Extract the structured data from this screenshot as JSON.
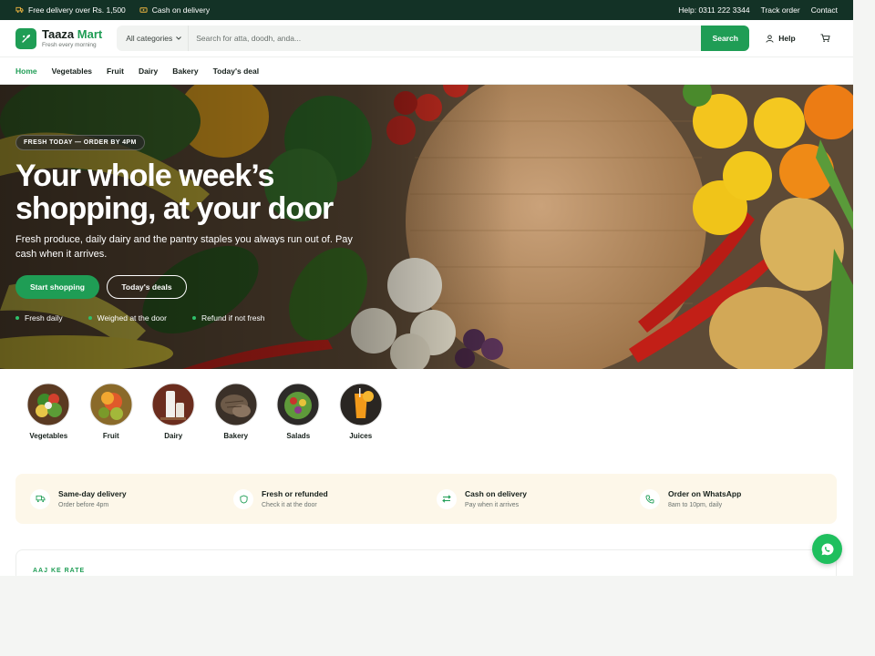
{
  "topbar": {
    "left": [
      {
        "icon": "truck-icon",
        "label": "Free delivery over Rs. 1,500"
      },
      {
        "icon": "cash-icon",
        "label": "Cash on delivery"
      }
    ],
    "right": [
      "Help: 0311 222 3344",
      "Track order",
      "Contact"
    ]
  },
  "header": {
    "brand_first": "Taaza",
    "brand_second": "Mart",
    "tagline": "Fresh every morning",
    "category_select": "All categories",
    "search_placeholder": "Search for atta, doodh, anda...",
    "search_button": "Search",
    "help_label": "Help"
  },
  "nav": [
    "Home",
    "Vegetables",
    "Fruit",
    "Dairy",
    "Bakery",
    "Today's deal"
  ],
  "hero": {
    "badge": "FRESH TODAY — ORDER BY 4PM",
    "title_line1": "Your whole week’s",
    "title_line2": "shopping, at your door",
    "subtitle": "Fresh produce, daily dairy and the pantry staples you always run out of. Pay cash when it arrives.",
    "primary_cta": "Start shopping",
    "secondary_cta": "Today's deals",
    "ticks": [
      "Fresh daily",
      "Weighed at the door",
      "Refund if not fresh"
    ]
  },
  "categories": [
    "Vegetables",
    "Fruit",
    "Dairy",
    "Bakery",
    "Salads",
    "Juices"
  ],
  "features": [
    {
      "icon": "truck-icon",
      "title": "Same-day delivery",
      "sub": "Order before 4pm"
    },
    {
      "icon": "shield-icon",
      "title": "Fresh or refunded",
      "sub": "Check it at the door"
    },
    {
      "icon": "swap-icon",
      "title": "Cash on delivery",
      "sub": "Pay when it arrives"
    },
    {
      "icon": "phone-icon",
      "title": "Order on WhatsApp",
      "sub": "8am to 10pm, daily"
    }
  ],
  "rates_kicker": "AAJ KE RATE",
  "colors": {
    "brand": "#1f9d55",
    "topbar": "#133226",
    "features_bg": "#fdf7e9"
  }
}
